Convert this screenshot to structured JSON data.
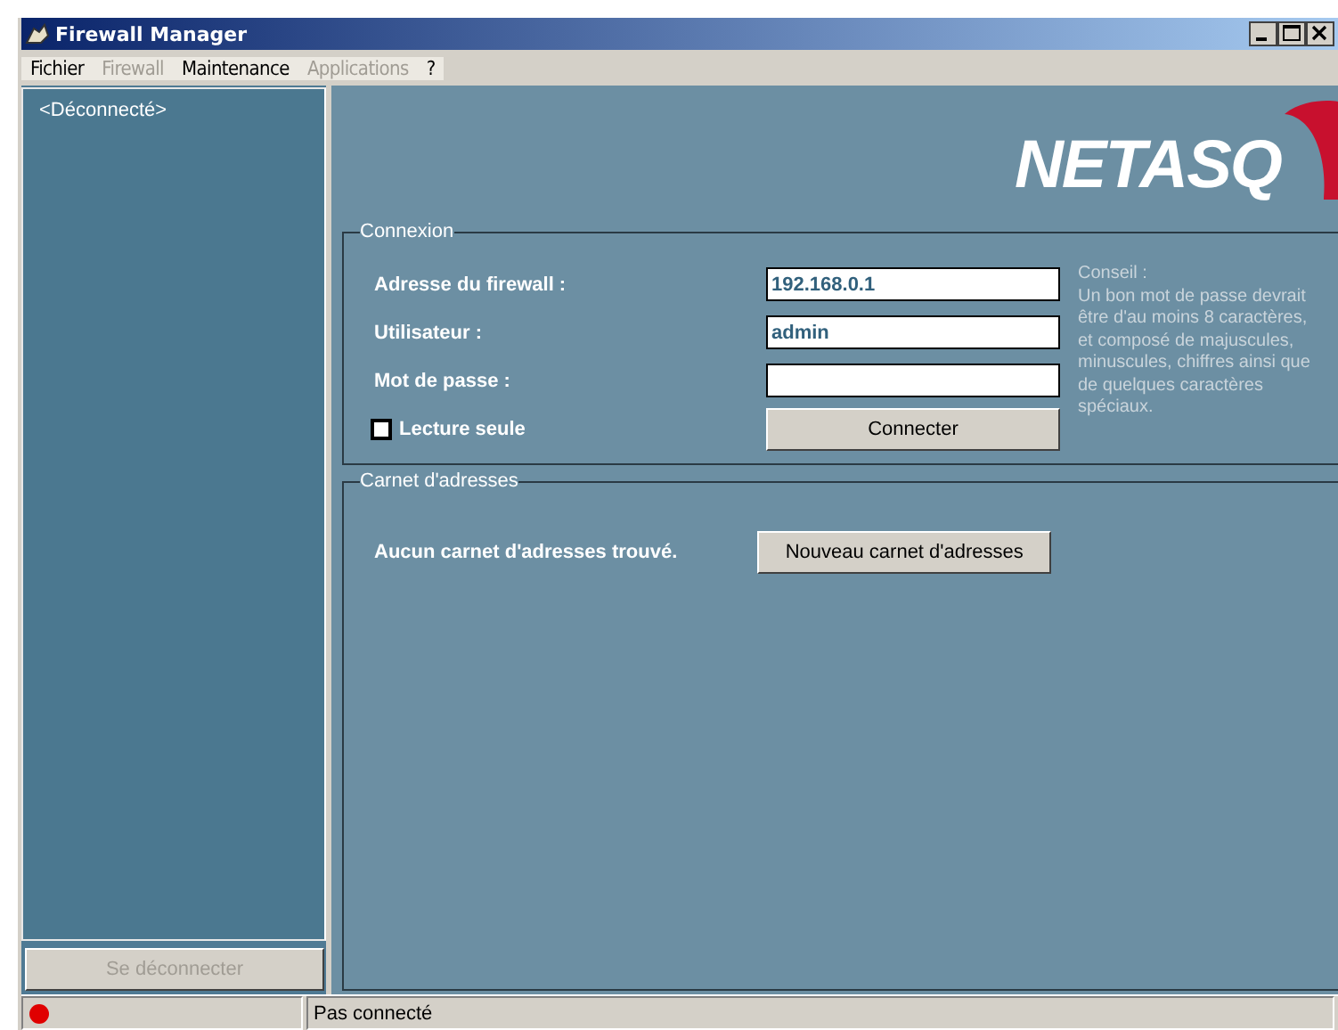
{
  "window": {
    "title": "Firewall Manager"
  },
  "menu": [
    {
      "label": "Fichier",
      "disabled": false
    },
    {
      "label": "Firewall",
      "disabled": true
    },
    {
      "label": "Maintenance",
      "disabled": false
    },
    {
      "label": "Applications",
      "disabled": true
    },
    {
      "label": "?",
      "disabled": false
    }
  ],
  "sidebar": {
    "items": [
      "<Déconnecté>"
    ],
    "button": {
      "label": "Se déconnecter",
      "disabled": true
    }
  },
  "logo": "NETASQ",
  "connexion": {
    "title": "Connexion",
    "fields": [
      {
        "label": "Adresse du firewall :",
        "value": "192.168.0.1"
      },
      {
        "label": "Utilisateur :",
        "value": "admin"
      },
      {
        "label": "Mot de passe :"
      }
    ],
    "checkbox": {
      "label": "Lecture seule",
      "checked": false
    },
    "button": "Connecter",
    "hint": [
      "Conseil :",
      "Un bon mot de passe devrait être d'au moins 8 caractères, et composé de majuscules, minuscules, chiffres ainsi que de quelques caractères spéciaux."
    ]
  },
  "address_book": {
    "title": "Carnet d'adresses",
    "message": "Aucun carnet d'adresses trouvé.",
    "button": "Nouveau carnet d'adresses"
  },
  "status_bar": {
    "connected": false,
    "text": "Pas connecté"
  }
}
